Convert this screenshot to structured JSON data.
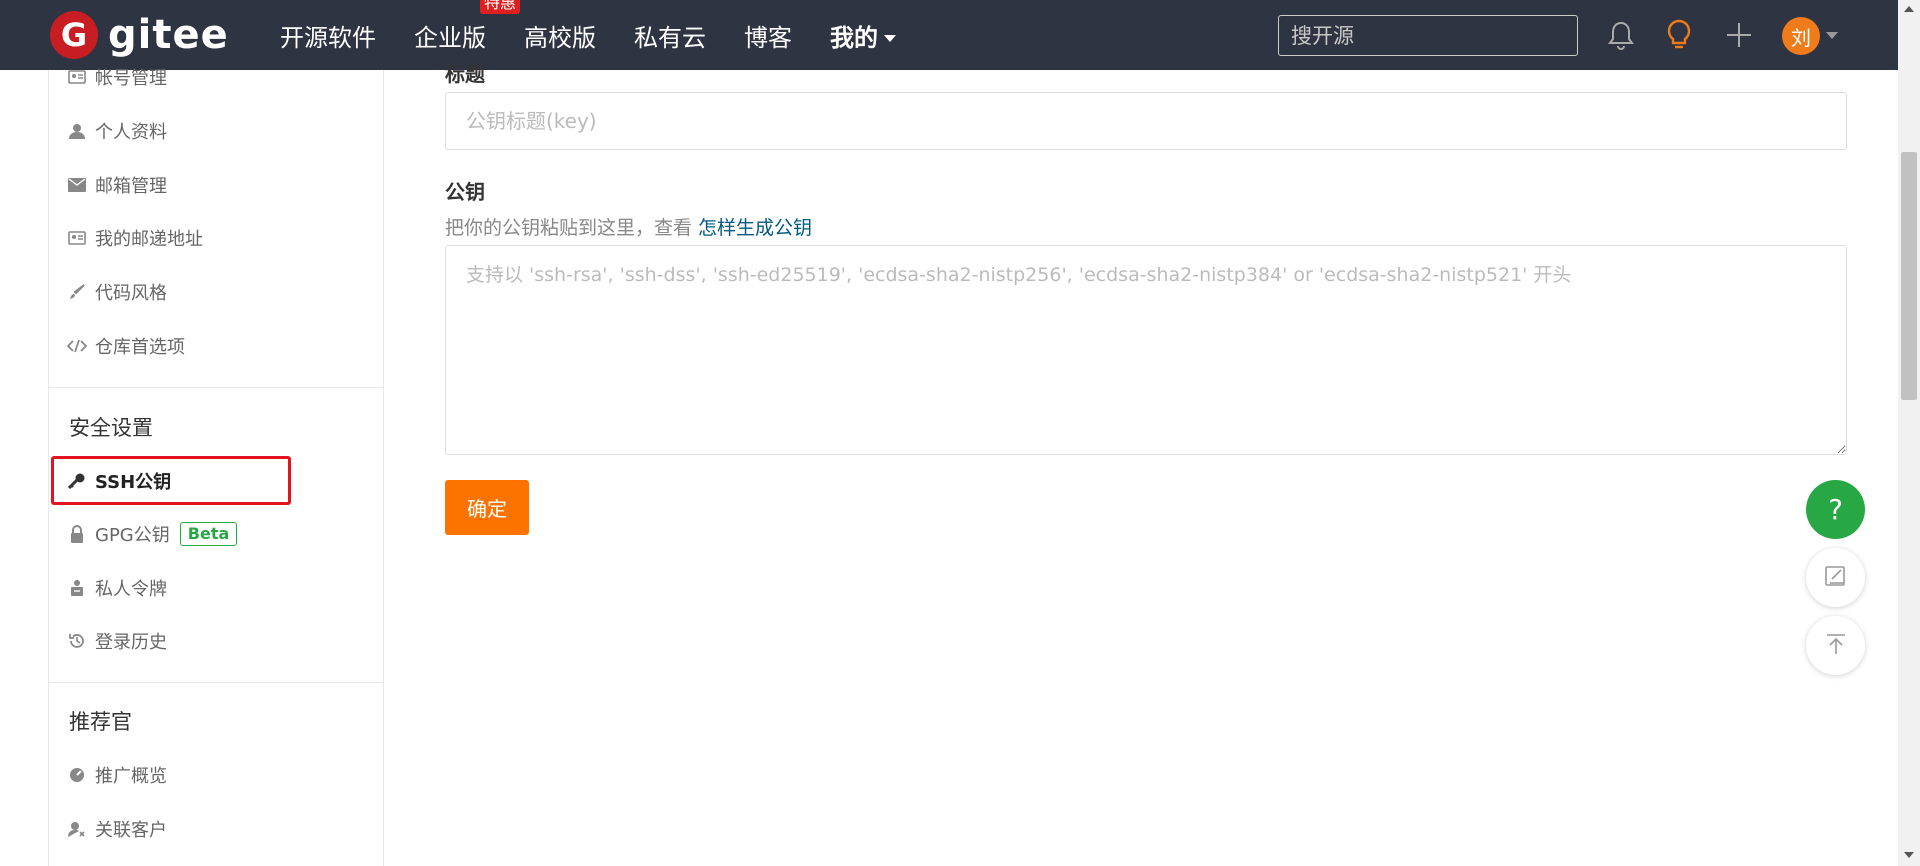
{
  "header": {
    "logo_letter": "G",
    "logo_text": "gitee",
    "nav": [
      {
        "label": "开源软件"
      },
      {
        "label": "企业版",
        "badge": "特惠"
      },
      {
        "label": "高校版"
      },
      {
        "label": "私有云"
      },
      {
        "label": "博客"
      },
      {
        "label": "我的"
      }
    ],
    "search_placeholder": "搜开源",
    "avatar_initial": "刘"
  },
  "sidebar": {
    "items_top": [
      {
        "label": "帐号管理",
        "icon": "id-card-icon"
      },
      {
        "label": "个人资料",
        "icon": "user-icon"
      },
      {
        "label": "邮箱管理",
        "icon": "envelope-icon"
      },
      {
        "label": "我的邮递地址",
        "icon": "address-card-icon"
      },
      {
        "label": "代码风格",
        "icon": "brush-icon"
      },
      {
        "label": "仓库首选项",
        "icon": "code-icon"
      }
    ],
    "security_heading": "安全设置",
    "security_items": [
      {
        "label": "SSH公钥",
        "icon": "key-icon",
        "active": true
      },
      {
        "label": "GPG公钥",
        "icon": "lock-icon",
        "badge": "Beta"
      },
      {
        "label": "私人令牌",
        "icon": "token-icon"
      },
      {
        "label": "登录历史",
        "icon": "history-icon"
      }
    ],
    "referral_heading": "推荐官",
    "referral_items": [
      {
        "label": "推广概览",
        "icon": "dashboard-icon"
      },
      {
        "label": "关联客户",
        "icon": "user-link-icon"
      }
    ]
  },
  "form": {
    "title_label": "标题",
    "title_placeholder": "公钥标题(key)",
    "key_label": "公钥",
    "hint_text": "把你的公钥粘贴到这里，查看 ",
    "hint_link": "怎样生成公钥",
    "key_placeholder": "支持以 'ssh-rsa', 'ssh-dss', 'ssh-ed25519', 'ecdsa-sha2-nistp256', 'ecdsa-sha2-nistp384' or 'ecdsa-sha2-nistp521' 开头",
    "submit_label": "确定"
  },
  "float": {
    "help_label": "?"
  },
  "colors": {
    "nav_bg": "#2e3441",
    "brand_red": "#c71d23",
    "submit_orange": "#fe7300",
    "help_green": "#28a745",
    "link_blue": "#005980",
    "highlight_red": "#e3131f"
  }
}
